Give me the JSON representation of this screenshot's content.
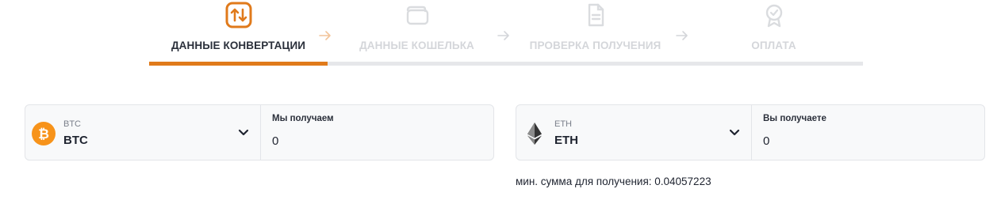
{
  "steps": [
    {
      "label": "ДАННЫЕ КОНВЕРТАЦИИ",
      "icon": "exchange-arrows-icon"
    },
    {
      "label": "ДАННЫЕ КОШЕЛЬКА",
      "icon": "wallet-icon"
    },
    {
      "label": "ПРОВЕРКА ПОЛУЧЕНИЯ",
      "icon": "document-icon"
    },
    {
      "label": "ОПЛАТА",
      "icon": "award-badge-icon"
    }
  ],
  "progress": {
    "current_step": 1,
    "total_steps": 4
  },
  "colors": {
    "accent": "#e07a1b",
    "inactive": "#d4d6da",
    "bitcoin": "#f7931a",
    "ethereum": "#343434"
  },
  "send": {
    "currency_small": "BTC",
    "currency_big": "BTC",
    "amount_label": "Мы получаем",
    "amount_value": "0",
    "icon": "bitcoin-icon"
  },
  "receive": {
    "currency_small": "ETH",
    "currency_big": "ETH",
    "amount_label": "Вы получаете",
    "amount_value": "0",
    "icon": "ethereum-icon"
  },
  "min_amount": "мин. сумма для получения: 0.04057223"
}
